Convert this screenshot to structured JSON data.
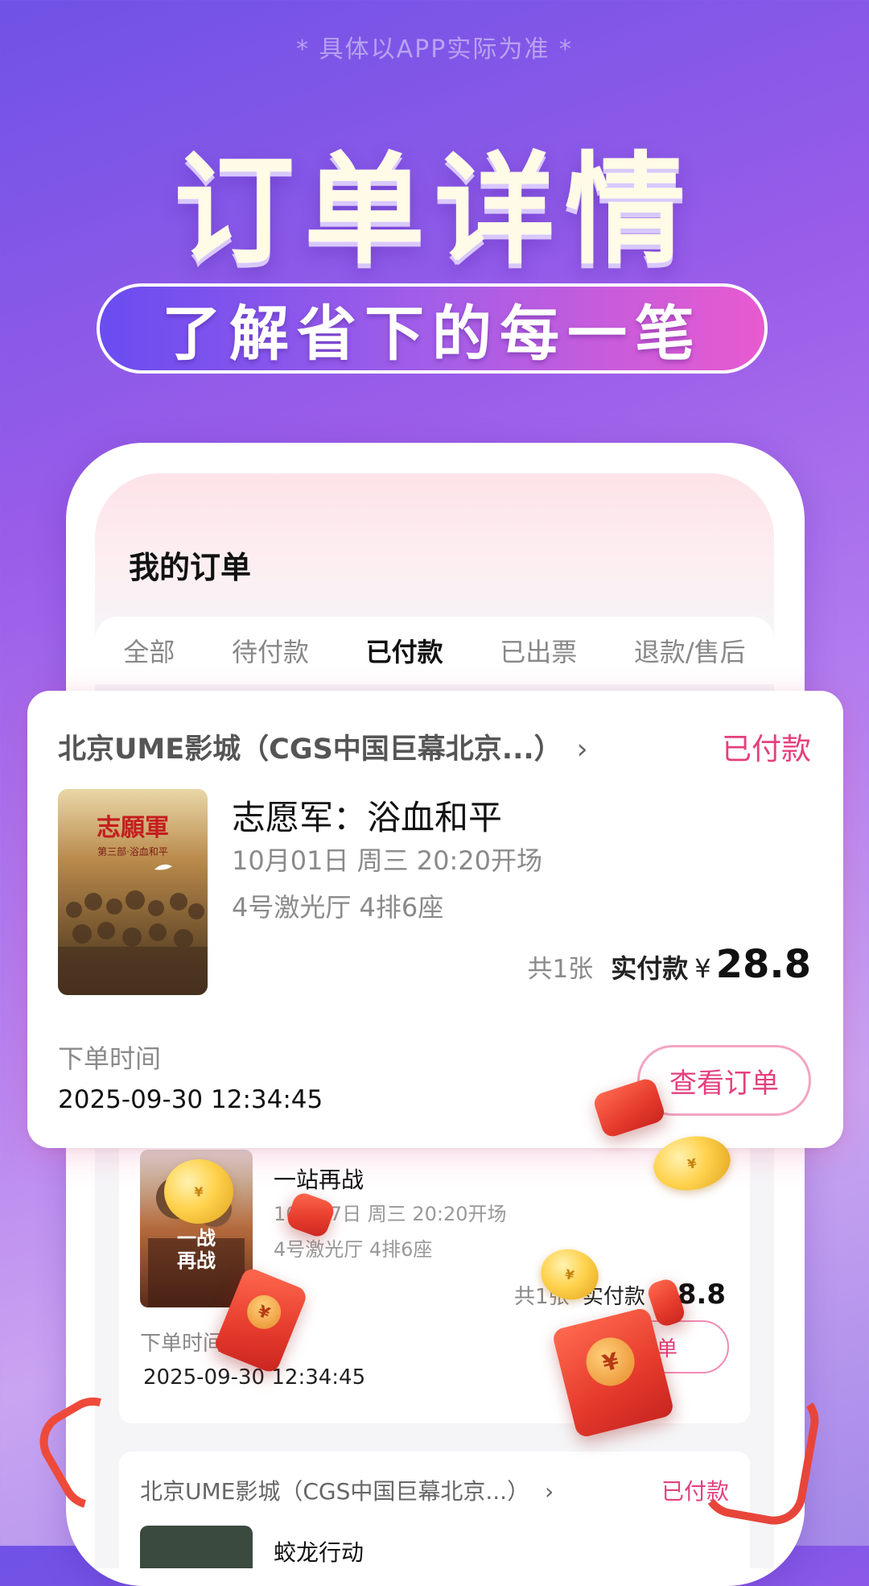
{
  "disclaimer": "* 具体以APP实际为准 *",
  "hero": {
    "title": "订单详情",
    "subtitle": "了解省下的每一笔"
  },
  "screen": {
    "title": "我的订单",
    "tabs": [
      "全部",
      "待付款",
      "已付款",
      "已出票",
      "退款/售后"
    ],
    "active_tab": "已付款"
  },
  "featured_order": {
    "cinema": "北京UME影城（CGS中国巨幕北京...）",
    "chevron": "›",
    "status": "已付款",
    "movie": "志愿军：浴血和平",
    "showtime": "10月01日  周三    20:20开场",
    "hall_seat": "4号激光厅 4排6座",
    "quantity": "共1张",
    "paid_label": "实付款",
    "currency": "¥",
    "price": "28.8",
    "order_time_label": "下单时间",
    "order_time": "2025-09-30 12:34:45",
    "view_button": "查看订单"
  },
  "second_order": {
    "movie": "一站再战",
    "showtime": "10月07日  周三    20:20开场",
    "hall_seat": "4号激光厅 4排6座",
    "quantity": "共1张",
    "paid_label": "实付款",
    "price": "28.8",
    "order_time_label": "下单时间",
    "order_time": "2025-09-30 12:34:45",
    "view_button": "订单"
  },
  "third_order": {
    "cinema": "北京UME影城（CGS中国巨幕北京...）",
    "chevron": "›",
    "status": "已付款",
    "movie": "蛟龙行动"
  },
  "colors": {
    "accent": "#e4407f",
    "background_start": "#6f52e6",
    "background_end": "#c9a4f1"
  }
}
